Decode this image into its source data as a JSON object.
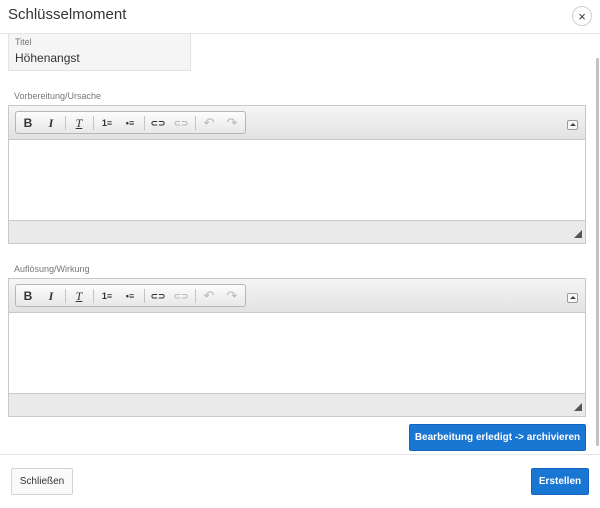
{
  "modal": {
    "title": "Schlüsselmoment",
    "close_icon": "×"
  },
  "title_field": {
    "label": "Titel",
    "value": "Höhenangst"
  },
  "editors": [
    {
      "label": "Vorbereitung/Ursache",
      "content": ""
    },
    {
      "label": "Auflösung/Wirkung",
      "content": ""
    }
  ],
  "toolbar_icons": {
    "bold": "B",
    "italic": "I",
    "remove_format": "T",
    "ordered_list": "1≡",
    "bullet_list": "•≡",
    "link": "⊂⊃",
    "unlink": "⊂⊃",
    "undo": "↶",
    "redo": "↷"
  },
  "buttons": {
    "archive": "Bearbeitung erledigt -> archivieren",
    "close": "Schließen",
    "create": "Erstellen"
  },
  "colors": {
    "primary": "#1976d2"
  }
}
